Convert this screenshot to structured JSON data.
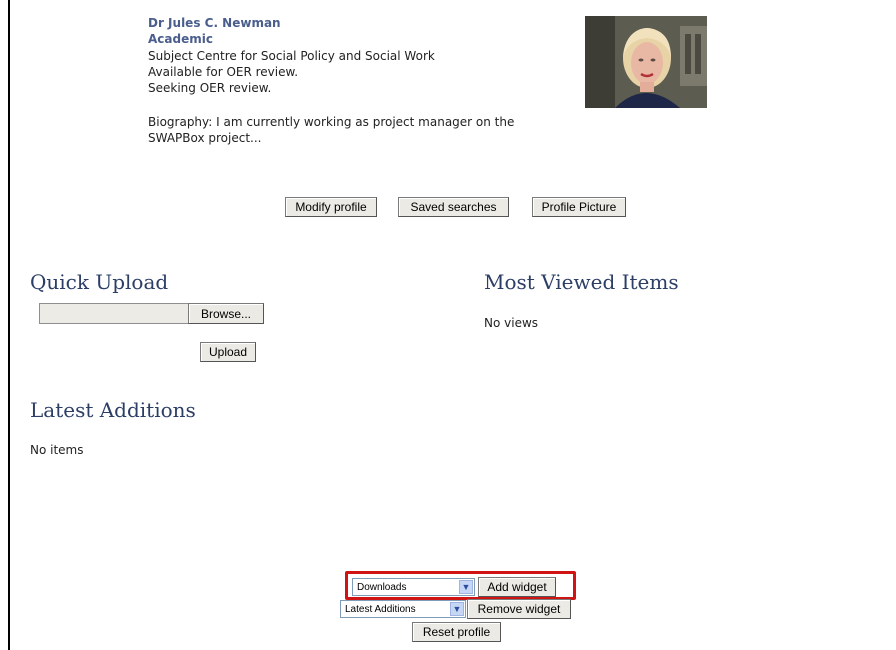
{
  "profile": {
    "name": "Dr Jules C. Newman",
    "role": "Academic",
    "department": "Subject Centre for Social Policy and Social Work",
    "review_available": "Available for OER review.",
    "review_seeking": "Seeking OER review.",
    "biography": [
      "Biography: I am currently working as project manager on the",
      "SWAPBox project..."
    ]
  },
  "profile_buttons": {
    "modify": "Modify profile",
    "saved_searches": "Saved searches",
    "profile_picture": "Profile Picture"
  },
  "quick_upload": {
    "heading": "Quick Upload",
    "browse_label": "Browse...",
    "upload_label": "Upload"
  },
  "most_viewed": {
    "heading": "Most Viewed Items",
    "empty_text": "No views"
  },
  "latest_additions": {
    "heading": "Latest Additions",
    "empty_text": "No items"
  },
  "widget_controls": {
    "add_select_value": "Downloads",
    "add_button": "Add widget",
    "remove_select_value": "Latest Additions",
    "remove_button": "Remove widget",
    "reset_button": "Reset profile"
  },
  "colors": {
    "highlight": "#d01414",
    "heading": "#2c3e66",
    "name": "#4a5d8c"
  }
}
